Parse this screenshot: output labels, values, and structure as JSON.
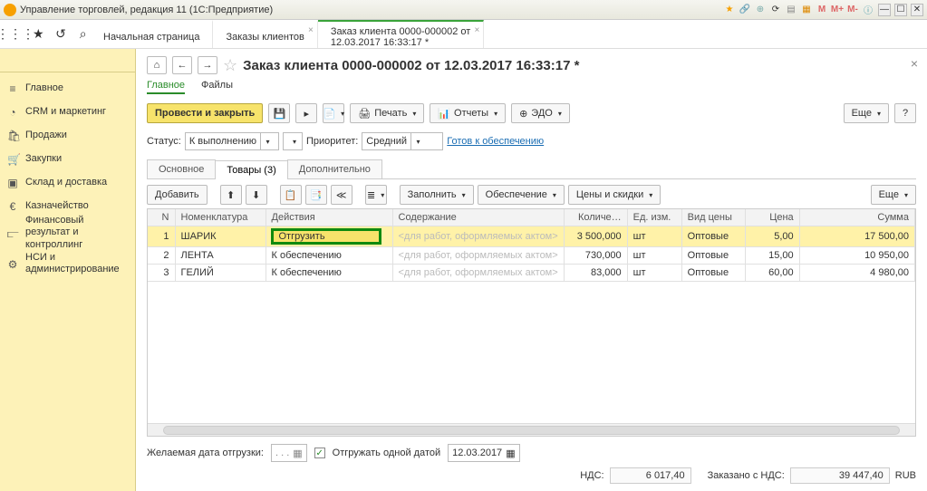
{
  "titlebar": {
    "title": "Управление торговлей, редакция 11  (1С:Предприятие)",
    "m1": "M",
    "m2": "M+",
    "m3": "M-"
  },
  "tabs": {
    "start": "Начальная страница",
    "orders": "Заказы клиентов",
    "order_l1": "Заказ клиента 0000-000002 от",
    "order_l2": "12.03.2017 16:33:17 *"
  },
  "sidebar": {
    "main": "Главное",
    "crm": "CRM и маркетинг",
    "sales": "Продажи",
    "purchase": "Закупки",
    "warehouse": "Склад и доставка",
    "treasury": "Казначейство",
    "finres_l1": "Финансовый результат и",
    "finres_l2": "контроллинг",
    "nsi_l1": "НСИ и",
    "nsi_l2": "администрирование"
  },
  "page": {
    "title": "Заказ клиента 0000-000002 от 12.03.2017 16:33:17 *",
    "sub_main": "Главное",
    "sub_files": "Файлы",
    "btn_post_close": "Провести и закрыть",
    "btn_print": "Печать",
    "btn_reports": "Отчеты",
    "btn_edo": "ЭДО",
    "btn_more": "Еще",
    "status_label": "Статус:",
    "status_value": "К выполнению",
    "priority_label": "Приоритет:",
    "priority_value": "Средний",
    "supply_link": "Готов к обеспечению",
    "inner_tabs": {
      "main": "Основное",
      "goods": "Товары (3)",
      "extra": "Дополнительно"
    },
    "tbl_toolbar": {
      "add": "Добавить",
      "fill": "Заполнить",
      "supply": "Обеспечение",
      "prices": "Цены и скидки",
      "more": "Еще"
    },
    "columns": {
      "n": "N",
      "nom": "Номенклатура",
      "act": "Действия",
      "content": "Содержание",
      "qty": "Количе…",
      "uom": "Ед. изм.",
      "pricetype": "Вид цены",
      "price": "Цена",
      "sum": "Сумма"
    },
    "rows": [
      {
        "n": "1",
        "nom": "ШАРИК",
        "act": "Отгрузить",
        "content": "<для работ, оформляемых актом>",
        "qty": "3 500,000",
        "uom": "шт",
        "pt": "Оптовые",
        "price": "5,00",
        "sum": "17 500,00",
        "sel": true,
        "hi": true
      },
      {
        "n": "2",
        "nom": "ЛЕНТА",
        "act": "К обеспечению",
        "content": "<для работ, оформляемых актом>",
        "qty": "730,000",
        "uom": "шт",
        "pt": "Оптовые",
        "price": "15,00",
        "sum": "10 950,00",
        "sel": false,
        "hi": false
      },
      {
        "n": "3",
        "nom": "ГЕЛИЙ",
        "act": "К обеспечению",
        "content": "<для работ, оформляемых актом>",
        "qty": "83,000",
        "uom": "шт",
        "pt": "Оптовые",
        "price": "60,00",
        "sum": "4 980,00",
        "sel": false,
        "hi": false
      }
    ],
    "ship_date_label": "Желаемая дата отгрузки:",
    "ship_date_empty": ". .  .",
    "ship_one_label": "Отгружать одной датой",
    "ship_one_date": "12.03.2017",
    "footer": {
      "nds_label": "НДС:",
      "nds_value": "6 017,40",
      "total_label": "Заказано с НДС:",
      "total_value": "39 447,40",
      "currency": "RUB"
    }
  }
}
